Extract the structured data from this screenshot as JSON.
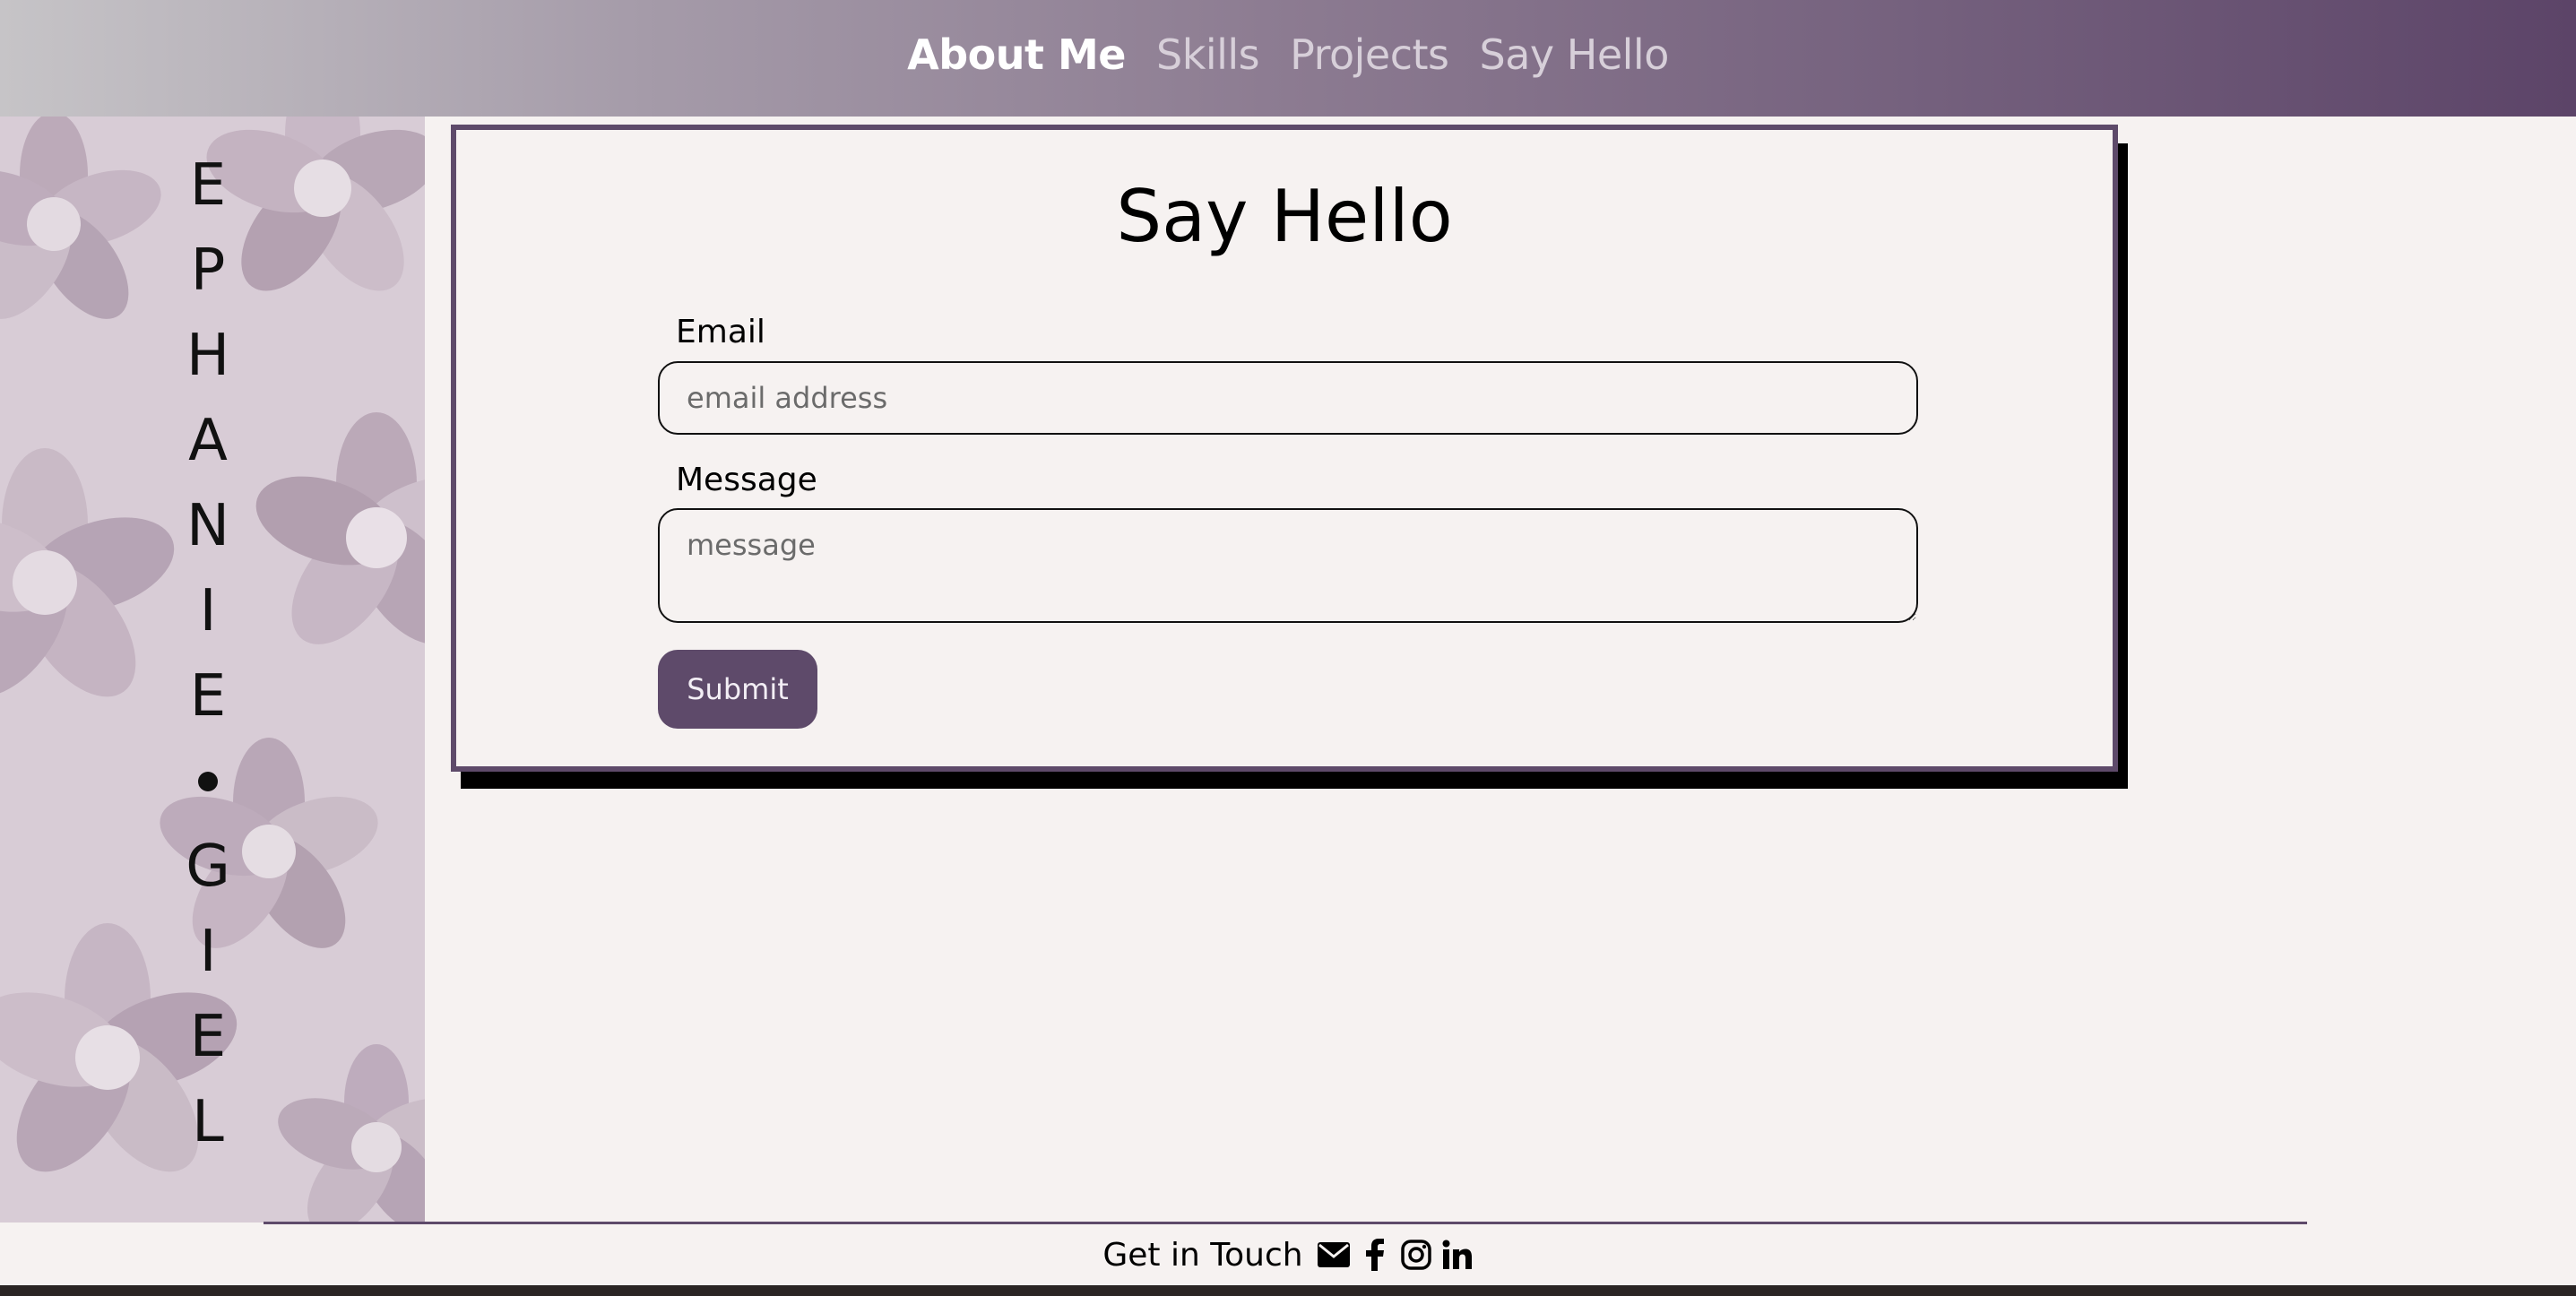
{
  "nav": {
    "items": [
      {
        "label": "About Me",
        "active": true
      },
      {
        "label": "Skills",
        "active": false
      },
      {
        "label": "Projects",
        "active": false
      },
      {
        "label": "Say Hello",
        "active": false
      }
    ]
  },
  "sidebar": {
    "name_letters": [
      "E",
      "P",
      "H",
      "A",
      "N",
      "I",
      "E",
      "G",
      "I",
      "E",
      "L"
    ],
    "background": "succulent-photo"
  },
  "contact": {
    "title": "Say Hello",
    "email_label": "Email",
    "email_placeholder": "email address",
    "message_label": "Message",
    "message_placeholder": "message",
    "submit_label": "Submit"
  },
  "footer": {
    "text": "Get in Touch",
    "icons": [
      "envelope-icon",
      "facebook-icon",
      "instagram-icon",
      "linkedin-icon"
    ]
  },
  "colors": {
    "accent": "#5e4a6a",
    "background": "#f6f2f1",
    "nav_gradient_start": "#c6c4c7",
    "nav_gradient_end": "#5c4468"
  }
}
